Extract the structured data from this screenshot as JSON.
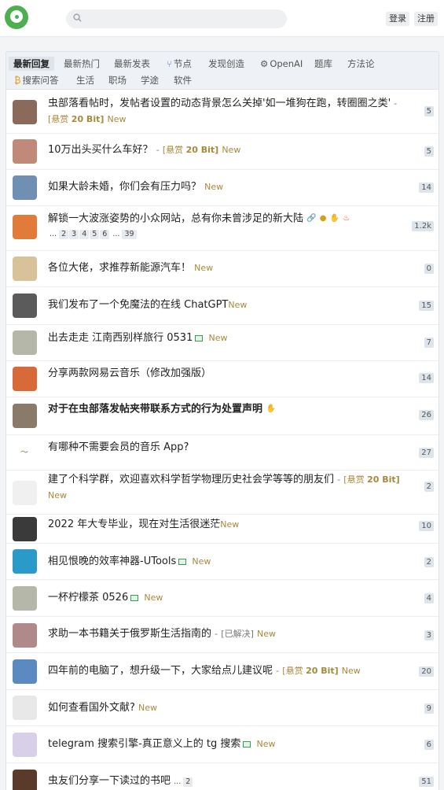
{
  "header": {
    "search_placeholder": "",
    "login_label": "登录",
    "register_label": "注册"
  },
  "tabs": [
    {
      "label": "最新回复",
      "active": true
    },
    {
      "label": "最新热门"
    },
    {
      "label": "最新发表"
    },
    {
      "label": "节点",
      "icon": "branch-icon"
    },
    {
      "label": "发现创造"
    },
    {
      "label": "OpenAI",
      "icon": "openai-icon"
    },
    {
      "label": "题库"
    },
    {
      "label": "方法论"
    },
    {
      "label": "搜索问答",
      "icon": "bitcoin-icon"
    },
    {
      "label": "生活"
    },
    {
      "label": "职场"
    },
    {
      "label": "学途"
    },
    {
      "label": "软件"
    }
  ],
  "topics": [
    {
      "title": "虫部落看帖时，发帖者设置的动态背景怎么关掉'如一堆狗在跑，转圈圈之类'",
      "dash": "-",
      "reward_prefix": "[悬赏",
      "reward_amount": "20 Bit]",
      "new": "New",
      "count": "5",
      "avatar_color": "#8a6a5a"
    },
    {
      "title": "10万出头买什么车好？",
      "dash": "-",
      "reward_prefix": "[悬赏",
      "reward_amount": "20 Bit]",
      "new": "New",
      "count": "5",
      "avatar_color": "#c08a7a"
    },
    {
      "title": "如果大龄未婚，你们会有压力吗？",
      "new": "New",
      "count": "14",
      "avatar_color": "#6f8fb3"
    },
    {
      "title": "解锁一大波涨姿势的小众网站，总有你未曾涉足的新大陆",
      "new": "",
      "count": "1.2k",
      "avatar_color": "#e07b39",
      "pages": [
        "...",
        "2",
        "3",
        "4",
        "5",
        "6",
        "...",
        "39"
      ]
    },
    {
      "title": "各位大佬，求推荐新能源汽车！",
      "new": "New",
      "count": "0",
      "avatar_color": "#d9c29a"
    },
    {
      "title": "我们发布了一个免魔法的在线 ChatGPT",
      "new": "New",
      "count": "15",
      "avatar_color": "#5b5b5b"
    },
    {
      "title": "出去走走 江南西别样旅行 0531",
      "new": "New",
      "count": "7",
      "avatar_color": "#b5b8a8"
    },
    {
      "title": "分享两款网易云音乐（修改加强版）",
      "new": "",
      "count": "14",
      "avatar_color": "#d86a3a"
    },
    {
      "title": "对于在虫部落发帖夹带联系方式的行为处置声明",
      "new": "",
      "count": "26",
      "avatar_color": "#8a7a6a",
      "bold": true
    },
    {
      "title": "有哪种不需要会员的音乐 App?",
      "new": "",
      "count": "27",
      "avatar_color": "#ffffff"
    },
    {
      "title": "建了个科学群，欢迎喜欢科学哲学物理历史社会学等等的朋友们",
      "dash": "-",
      "reward_prefix": "[悬赏",
      "reward_amount": "20 Bit]",
      "new": "New",
      "count": "2",
      "avatar_color": "#f0f0f0"
    },
    {
      "title": "2022 年大专毕业，现在对生活很迷茫",
      "new": "New",
      "count": "10",
      "avatar_color": "#3a3a3a"
    },
    {
      "title": "相见恨晚的效率神器-UTools",
      "new": "New",
      "count": "2",
      "avatar_color": "#2a9ac8"
    },
    {
      "title": "一杯柠檬茶 0526",
      "new": "New",
      "count": "4",
      "avatar_color": "#b5b8a8"
    },
    {
      "title": "求助一本书籍关于俄罗斯生活指南的",
      "dash": "-",
      "solved": "[已解决]",
      "new": "New",
      "count": "3",
      "avatar_color": "#b08a8a"
    },
    {
      "title": "四年前的电脑了，想升级一下，大家给点儿建议呢",
      "dash": "-",
      "reward_prefix": "[悬赏",
      "reward_amount": "20 Bit]",
      "new": "New",
      "count": "20",
      "avatar_color": "#5a8ac0"
    },
    {
      "title": "如何查看国外文献?",
      "new": "New",
      "count": "9",
      "avatar_color": "#e8e8e8"
    },
    {
      "title": "telegram 搜索引擎-真正意义上的 tg 搜索",
      "new": "New",
      "count": "6",
      "avatar_color": "#d8d0e8"
    },
    {
      "title": "虫友们分享一下读过的书吧",
      "new": "",
      "count": "51",
      "avatar_color": "#5a3a2a",
      "pages": [
        "...",
        "2"
      ]
    }
  ]
}
